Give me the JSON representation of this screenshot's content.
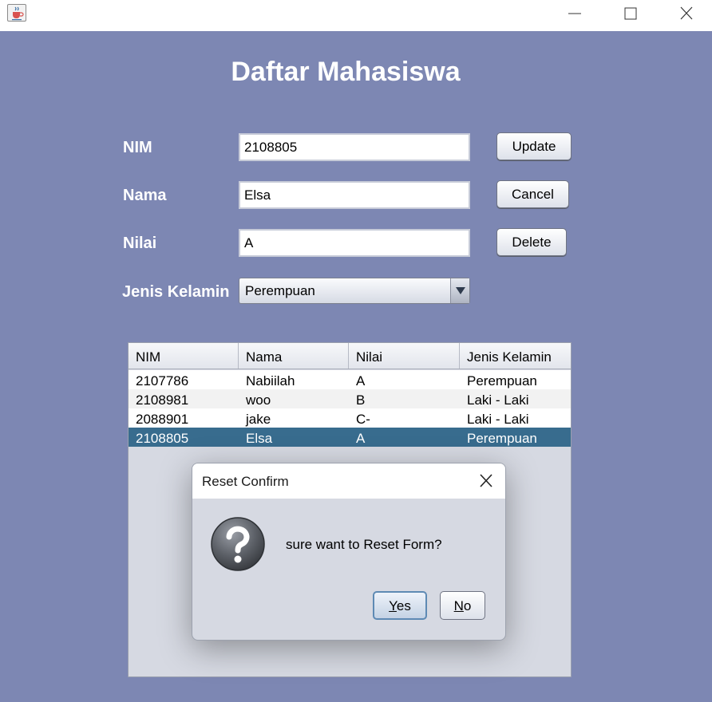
{
  "form": {
    "title": "Daftar Mahasiswa",
    "labels": {
      "nim": "NIM",
      "nama": "Nama",
      "nilai": "Nilai",
      "jenis_kelamin": "Jenis Kelamin"
    },
    "values": {
      "nim": "2108805",
      "nama": "Elsa",
      "nilai": "A",
      "jenis_kelamin": "Perempuan"
    },
    "buttons": {
      "update": "Update",
      "cancel": "Cancel",
      "delete": "Delete"
    }
  },
  "table": {
    "columns": [
      "NIM",
      "Nama",
      "Nilai",
      "Jenis Kelamin"
    ],
    "rows": [
      [
        "2107786",
        "Nabiilah",
        "A",
        "Perempuan"
      ],
      [
        "2108981",
        "woo",
        "B",
        "Laki - Laki"
      ],
      [
        "2088901",
        "jake",
        "C-",
        "Laki - Laki"
      ],
      [
        "2108805",
        "Elsa",
        "A",
        "Perempuan"
      ]
    ],
    "selected_row": 3
  },
  "dialog": {
    "title": "Reset Confirm",
    "message": "sure want to Reset Form?",
    "yes_label": "Yes",
    "no_label": "No"
  },
  "colors": {
    "panel_bg": "#7d87b3",
    "selection": "#386c8e",
    "row_alt": "#f2f2f2"
  },
  "icons": {
    "window_app": "java-cup-icon",
    "minimize": "minimize-icon",
    "maximize": "maximize-icon",
    "close": "close-icon",
    "dialog_question": "question-icon",
    "combo_arrow": "chevron-down-icon"
  }
}
